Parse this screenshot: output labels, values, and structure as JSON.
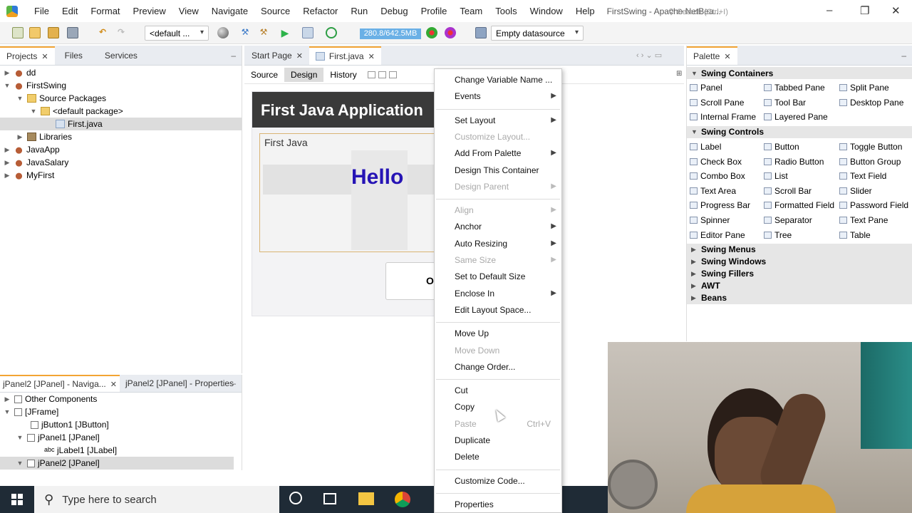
{
  "menubar": {
    "items": [
      "File",
      "Edit",
      "Format",
      "Preview",
      "View",
      "Navigate",
      "Source",
      "Refactor",
      "Run",
      "Debug",
      "Profile",
      "Team",
      "Tools",
      "Window",
      "Help"
    ],
    "window_title": "FirstSwing - Apache NetBea...",
    "search_placeholder": "Search (Ctrl+I)"
  },
  "toolbar": {
    "config_combo": "<default ...",
    "memory": "280.8/642.5MB",
    "datasource_combo": "Empty datasource"
  },
  "projects": {
    "tabs": [
      "Projects",
      "Files",
      "Services"
    ],
    "tree": [
      "dd",
      "FirstSwing",
      "Source Packages",
      "<default package>",
      "First.java",
      "Libraries",
      "JavaApp",
      "JavaSalary",
      "MyFirst"
    ]
  },
  "navigator": {
    "tabs": [
      "jPanel2 [JPanel] - Naviga...",
      "jPanel2 [JPanel] - Properties"
    ],
    "tree": [
      "Other Components",
      "[JFrame]",
      "jButton1 [JButton]",
      "jPanel1 [JPanel]",
      "jLabel1 [JLabel]",
      "jPanel2 [JPanel]"
    ]
  },
  "editor": {
    "tabs": [
      "Start Page",
      "First.java"
    ],
    "views": [
      "Source",
      "Design",
      "History"
    ],
    "frame_title": "First Java Application",
    "panel_title": "First Java",
    "label_text": "Hello",
    "button_partial": "O"
  },
  "palette": {
    "tab": "Palette",
    "categories": [
      {
        "name": "Swing Containers",
        "expanded": true,
        "items": [
          "Panel",
          "Tabbed Pane",
          "Split Pane",
          "Scroll Pane",
          "Tool Bar",
          "Desktop Pane",
          "Internal Frame",
          "Layered Pane"
        ]
      },
      {
        "name": "Swing Controls",
        "expanded": true,
        "items": [
          "Label",
          "Button",
          "Toggle Button",
          "Check Box",
          "Radio Button",
          "Button Group",
          "Combo Box",
          "List",
          "Text Field",
          "Text Area",
          "Scroll Bar",
          "Slider",
          "Progress Bar",
          "Formatted Field",
          "Password Field",
          "Spinner",
          "Separator",
          "Text Pane",
          "Editor Pane",
          "Tree",
          "Table"
        ]
      },
      {
        "name": "Swing Menus",
        "expanded": false,
        "items": []
      },
      {
        "name": "Swing Windows",
        "expanded": false,
        "items": []
      },
      {
        "name": "Swing Fillers",
        "expanded": false,
        "items": []
      },
      {
        "name": "AWT",
        "expanded": false,
        "items": []
      },
      {
        "name": "Beans",
        "expanded": false,
        "items": []
      }
    ]
  },
  "context_menu": {
    "items": [
      {
        "label": "Change Variable Name ...",
        "enabled": true,
        "submenu": false
      },
      {
        "label": "Events",
        "enabled": true,
        "submenu": true
      },
      {
        "sep": true
      },
      {
        "label": "Set Layout",
        "enabled": true,
        "submenu": true
      },
      {
        "label": "Customize Layout...",
        "enabled": false,
        "submenu": false
      },
      {
        "label": "Add From Palette",
        "enabled": true,
        "submenu": true
      },
      {
        "label": "Design This Container",
        "enabled": true,
        "submenu": false
      },
      {
        "label": "Design Parent",
        "enabled": false,
        "submenu": true
      },
      {
        "sep": true
      },
      {
        "label": "Align",
        "enabled": false,
        "submenu": true
      },
      {
        "label": "Anchor",
        "enabled": true,
        "submenu": true
      },
      {
        "label": "Auto Resizing",
        "enabled": true,
        "submenu": true
      },
      {
        "label": "Same Size",
        "enabled": false,
        "submenu": true
      },
      {
        "label": "Set to Default Size",
        "enabled": true,
        "submenu": false
      },
      {
        "label": "Enclose In",
        "enabled": true,
        "submenu": true
      },
      {
        "label": "Edit Layout Space...",
        "enabled": true,
        "submenu": false
      },
      {
        "sep": true
      },
      {
        "label": "Move Up",
        "enabled": true,
        "submenu": false
      },
      {
        "label": "Move Down",
        "enabled": false,
        "submenu": false
      },
      {
        "label": "Change Order...",
        "enabled": true,
        "submenu": false
      },
      {
        "sep": true
      },
      {
        "label": "Cut",
        "enabled": true,
        "submenu": false
      },
      {
        "label": "Copy",
        "enabled": true,
        "submenu": false
      },
      {
        "label": "Paste",
        "enabled": false,
        "submenu": false,
        "accel": "Ctrl+V"
      },
      {
        "label": "Duplicate",
        "enabled": true,
        "submenu": false
      },
      {
        "label": "Delete",
        "enabled": true,
        "submenu": false
      },
      {
        "sep": true
      },
      {
        "label": "Customize Code...",
        "enabled": true,
        "submenu": false
      },
      {
        "sep": true
      },
      {
        "label": "Properties",
        "enabled": true,
        "submenu": false
      }
    ]
  },
  "taskbar": {
    "search_placeholder": "Type here to search"
  },
  "colors": {
    "accent_tab": "#f3a433",
    "label_text": "#2614b5",
    "frame_title_bg": "#3a3a3a",
    "taskbar_bg": "#1f2b36"
  }
}
